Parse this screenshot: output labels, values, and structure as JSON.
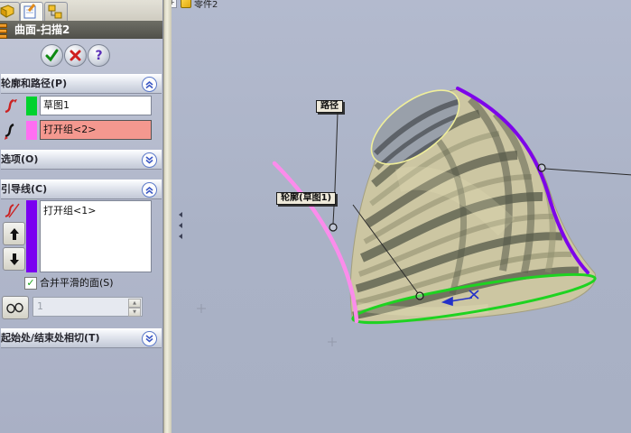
{
  "pm": {
    "title": "曲面-扫描2",
    "buttons": {
      "help": "?"
    },
    "sections": {
      "profile_path": {
        "label": "轮廓和路径(P)",
        "collapsed": false
      },
      "options": {
        "label": "选项(O)",
        "collapsed": true
      },
      "guides": {
        "label": "引导线(C)",
        "collapsed": false
      },
      "tangency": {
        "label": "起始处/结束处相切(T)",
        "collapsed": true
      }
    },
    "fields": {
      "profile_value": "草图1",
      "path_value": "打开组<2>",
      "guide_value": "打开组<1>",
      "merge_label": "合并平滑的面(S)",
      "sections_count": "1"
    },
    "colors": {
      "profile_swatch": "#00d22d",
      "path_swatch": "#ff6ef2",
      "guide_swatch": "#7a00f0",
      "selected_bg": "#f4988f"
    }
  },
  "viewport": {
    "tree_item_label": "零件2",
    "callouts": {
      "path": "路径",
      "profile": "轮廓(草图1)"
    },
    "colors": {
      "path_curve": "#fb8ceb",
      "guide_curve": "#7d05ea",
      "profile_edge": "#1ed321",
      "rim": "#f0ef9a",
      "background": "#aab2c6"
    }
  }
}
